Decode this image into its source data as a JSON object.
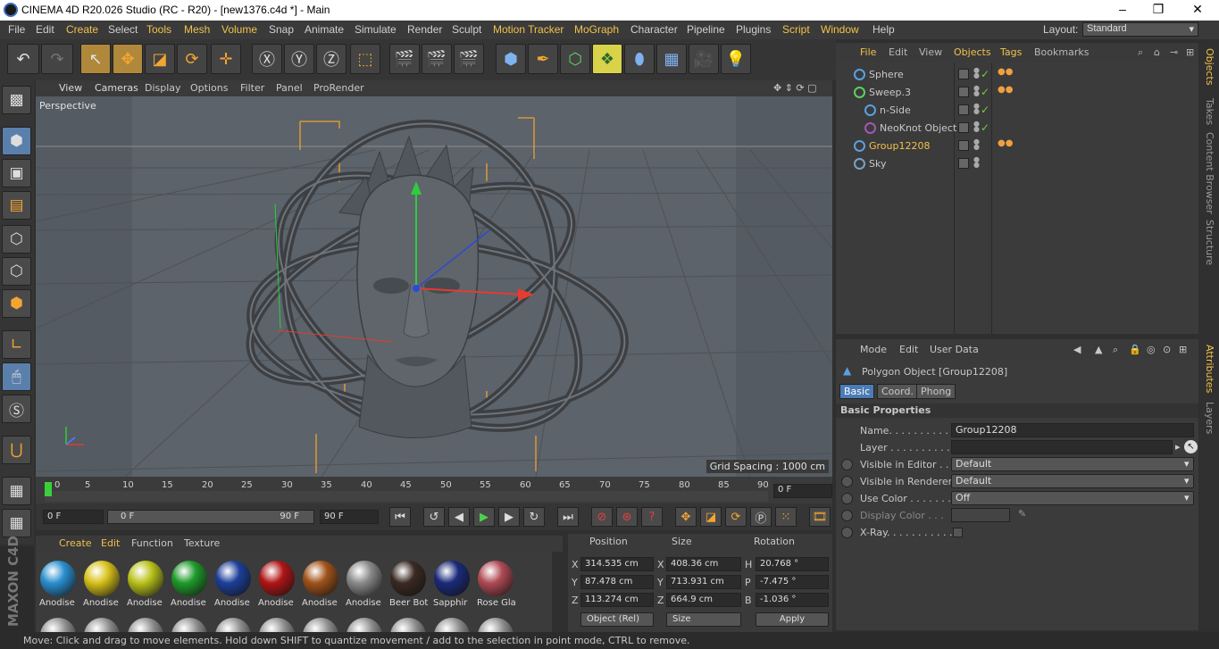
{
  "titlebar": {
    "title": "CINEMA 4D R20.026 Studio (RC - R20) - [new1376.c4d *] - Main",
    "minimize": "–",
    "maximize": "❐",
    "close": "✕"
  },
  "menubar": {
    "items": [
      "File",
      "Edit",
      "Create",
      "Select",
      "Tools",
      "Mesh",
      "Volume",
      "Snap",
      "Animate",
      "Simulate",
      "Render",
      "Sculpt",
      "Motion Tracker",
      "MoGraph",
      "Character",
      "Pipeline",
      "Plugins",
      "Script",
      "Window",
      "Help"
    ],
    "layout_label": "Layout:",
    "layout_value": "Standard"
  },
  "viewport_menu": [
    "View",
    "Cameras",
    "Display",
    "Options",
    "Filter",
    "Panel",
    "ProRender"
  ],
  "viewport": {
    "label": "Perspective",
    "grid_spacing": "Grid Spacing : 1000 cm"
  },
  "timeline": {
    "ticks": [
      "0",
      "5",
      "10",
      "15",
      "20",
      "25",
      "30",
      "35",
      "40",
      "45",
      "50",
      "55",
      "60",
      "65",
      "70",
      "75",
      "80",
      "85",
      "90"
    ],
    "current_frame": "0 F"
  },
  "playback": {
    "start": "0 F",
    "range_start": "0 F",
    "range_end": "90 F",
    "end": "90 F"
  },
  "materials_menu": [
    "Create",
    "Edit",
    "Function",
    "Texture"
  ],
  "materials": [
    {
      "name": "Anodise",
      "color": "#2a8fd0"
    },
    {
      "name": "Anodise",
      "color": "#d8c21a"
    },
    {
      "name": "Anodise",
      "color": "#b9c21a"
    },
    {
      "name": "Anodise",
      "color": "#1e9a2a"
    },
    {
      "name": "Anodise",
      "color": "#1d3f9a"
    },
    {
      "name": "Anodise",
      "color": "#b01515"
    },
    {
      "name": "Anodise",
      "color": "#a0521a"
    },
    {
      "name": "Anodise",
      "color": "#8a8a8a"
    },
    {
      "name": "Beer Bot",
      "color": "#3a2a22"
    },
    {
      "name": "Sapphir",
      "color": "#1b2a7a"
    },
    {
      "name": "Rose Gla",
      "color": "#b04a55"
    }
  ],
  "coords": {
    "headers": [
      "Position",
      "Size",
      "Rotation"
    ],
    "axes": [
      "X",
      "Y",
      "Z"
    ],
    "position": [
      "314.535 cm",
      "87.478 cm",
      "113.274 cm"
    ],
    "size_axes": [
      "X",
      "Y",
      "Z"
    ],
    "size": [
      "408.36 cm",
      "713.931 cm",
      "664.9 cm"
    ],
    "rot_axes": [
      "H",
      "P",
      "B"
    ],
    "rotation": [
      "20.768 °",
      "-7.475 °",
      "-1.036 °"
    ],
    "mode_dropdown": "Object (Rel)",
    "size_dropdown": "Size",
    "apply_label": "Apply"
  },
  "status": "Move: Click and drag to move elements. Hold down SHIFT to quantize movement / add to the selection in point mode, CTRL to remove.",
  "object_manager": {
    "menu": [
      "File",
      "Edit",
      "View",
      "Objects",
      "Tags",
      "Bookmarks"
    ],
    "objects": [
      {
        "name": "Sphere",
        "indent": 0,
        "icon_color": "#5aa0e0",
        "tag": true,
        "tick": true,
        "highlight": false
      },
      {
        "name": "Sweep.3",
        "indent": 0,
        "icon_color": "#5fcf5f",
        "tag": true,
        "tick": true,
        "highlight": false
      },
      {
        "name": "n-Side",
        "indent": 1,
        "icon_color": "#5aa0e0",
        "tag": false,
        "tick": true,
        "highlight": false
      },
      {
        "name": "NeoKnot Object",
        "indent": 1,
        "icon_color": "#a05ab0",
        "tag": false,
        "tick": true,
        "highlight": false
      },
      {
        "name": "Group12208",
        "indent": 0,
        "icon_color": "#5aa0e0",
        "tag": true,
        "tick": false,
        "highlight": true
      },
      {
        "name": "Sky",
        "indent": 0,
        "icon_color": "#7aa0c8",
        "tag": false,
        "tick": false,
        "highlight": false
      }
    ]
  },
  "side_tabs_top": [
    "Objects",
    "Takes",
    "Content Browser",
    "Structure"
  ],
  "side_tabs_bottom": [
    "Attributes",
    "Layers"
  ],
  "attributes": {
    "menu": [
      "Mode",
      "Edit",
      "User Data"
    ],
    "title": "Polygon Object [Group12208]",
    "tabs": [
      "Basic",
      "Coord.",
      "Phong"
    ],
    "section": "Basic Properties",
    "rows": [
      {
        "label": "Name. . . . . . . . . . . . .",
        "value": "Group12208",
        "type": "text"
      },
      {
        "label": "Layer . . . . . . . . . . . . .",
        "value": "",
        "type": "text"
      },
      {
        "label": "Visible in Editor . . .",
        "value": "Default",
        "type": "dropdown"
      },
      {
        "label": "Visible in Renderer",
        "value": "Default",
        "type": "dropdown"
      },
      {
        "label": "Use Color . . . . . . . .",
        "value": "Off",
        "type": "dropdown"
      },
      {
        "label": "Display Color . . .",
        "value": "",
        "type": "color"
      },
      {
        "label": "X-Ray. . . . . . . . . . . .",
        "value": "",
        "type": "checkbox"
      }
    ]
  }
}
